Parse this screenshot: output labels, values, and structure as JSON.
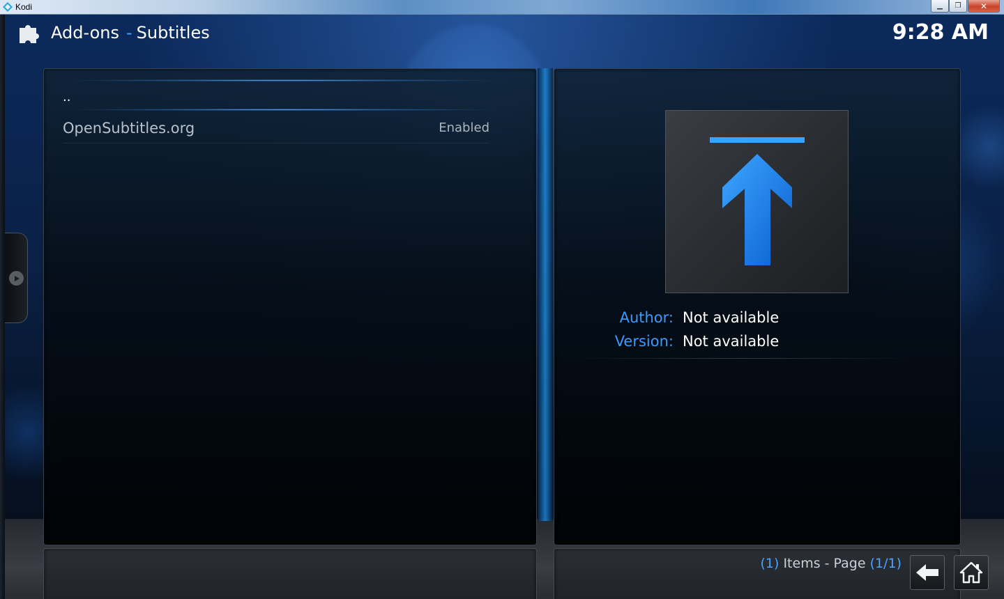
{
  "window": {
    "title": "Kodi",
    "minimize_glyph": "▁",
    "maximize_glyph": "❐",
    "close_glyph": "✕"
  },
  "header": {
    "section": "Add-ons",
    "separator": "-",
    "subsection": "Subtitles",
    "icon": "puzzle-piece-icon"
  },
  "clock": "9:28 AM",
  "list": {
    "parent_label": "..",
    "items": [
      {
        "name": "OpenSubtitles.org",
        "status": "Enabled"
      }
    ]
  },
  "info": {
    "thumbnail_icon": "arrow-up-icon",
    "author_label": "Author:",
    "author_value": "Not available",
    "version_label": "Version:",
    "version_value": "Not available"
  },
  "footer": {
    "items_open": "(",
    "items_count": "1",
    "items_close": ")",
    "items_text": " Items - Page ",
    "page_open": "(",
    "page_value": "1/1",
    "page_close": ")",
    "back_icon": "back-arrow-icon",
    "home_icon": "home-icon"
  },
  "colors": {
    "accent": "#3a9bff",
    "text": "#ffffff",
    "muted_text": "#b9c2cb"
  }
}
